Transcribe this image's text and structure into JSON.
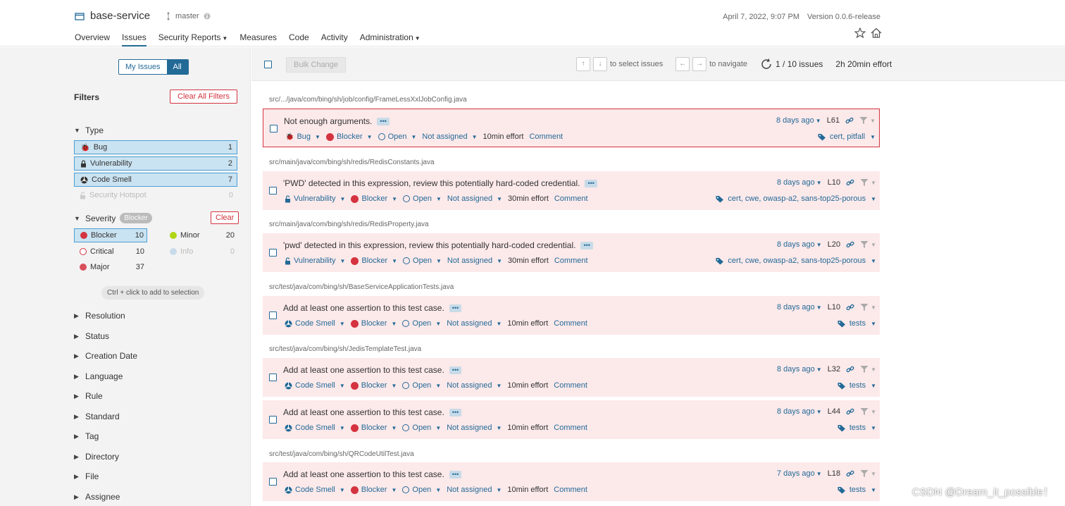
{
  "header": {
    "project": "base-service",
    "branch": "master",
    "date": "April 7, 2022, 9:07 PM",
    "version": "Version 0.0.6-release",
    "nav": [
      "Overview",
      "Issues",
      "Security Reports",
      "Measures",
      "Code",
      "Activity",
      "Administration"
    ],
    "active_nav": "Issues"
  },
  "sidebar": {
    "my_issues": "My Issues",
    "all": "All",
    "filters_title": "Filters",
    "clear_all": "Clear All Filters",
    "type": {
      "label": "Type",
      "items": [
        {
          "label": "Bug",
          "count": "1"
        },
        {
          "label": "Vulnerability",
          "count": "2"
        },
        {
          "label": "Code Smell",
          "count": "7"
        },
        {
          "label": "Security Hotspot",
          "count": "0"
        }
      ]
    },
    "severity": {
      "label": "Severity",
      "badge": "Blocker",
      "clear": "Clear",
      "items": [
        {
          "label": "Blocker",
          "count": "10"
        },
        {
          "label": "Minor",
          "count": "20"
        },
        {
          "label": "Critical",
          "count": "10"
        },
        {
          "label": "Info",
          "count": "0"
        },
        {
          "label": "Major",
          "count": "37"
        }
      ],
      "hint": "Ctrl + click to add to selection"
    },
    "facets": [
      "Resolution",
      "Status",
      "Creation Date",
      "Language",
      "Rule",
      "Standard",
      "Tag",
      "Directory",
      "File",
      "Assignee"
    ]
  },
  "toolbar": {
    "bulk": "Bulk Change",
    "up": "↑",
    "down": "↓",
    "select_hint": "to select issues",
    "left": "←",
    "right": "→",
    "nav_hint": "to navigate",
    "count": "1 / 10 issues",
    "effort": "2h 20min effort"
  },
  "issues": [
    {
      "path": "src/.../java/com/bing/sh/job/config/FrameLessXxlJobConfig.java",
      "title": "Not enough arguments.",
      "type": "Bug",
      "severity": "Blocker",
      "status": "Open",
      "assignee": "Not assigned",
      "effort": "10min effort",
      "comment": "Comment",
      "age": "8 days ago",
      "line": "L61",
      "tags": "cert, pitfall"
    },
    {
      "path": "src/main/java/com/bing/sh/redis/RedisConstants.java",
      "title": "'PWD' detected in this expression, review this potentially hard-coded credential.",
      "type": "Vulnerability",
      "severity": "Blocker",
      "status": "Open",
      "assignee": "Not assigned",
      "effort": "30min effort",
      "comment": "Comment",
      "age": "8 days ago",
      "line": "L10",
      "tags": "cert, cwe, owasp-a2, sans-top25-porous"
    },
    {
      "path": "src/main/java/com/bing/sh/redis/RedisProperty.java",
      "title": "'pwd' detected in this expression, review this potentially hard-coded credential.",
      "type": "Vulnerability",
      "severity": "Blocker",
      "status": "Open",
      "assignee": "Not assigned",
      "effort": "30min effort",
      "comment": "Comment",
      "age": "8 days ago",
      "line": "L20",
      "tags": "cert, cwe, owasp-a2, sans-top25-porous"
    },
    {
      "path": "src/test/java/com/bing/sh/BaseServiceApplicationTests.java",
      "title": "Add at least one assertion to this test case.",
      "type": "Code Smell",
      "severity": "Blocker",
      "status": "Open",
      "assignee": "Not assigned",
      "effort": "10min effort",
      "comment": "Comment",
      "age": "8 days ago",
      "line": "L10",
      "tags": "tests"
    },
    {
      "path": "src/test/java/com/bing/sh/JedisTemplateTest.java",
      "title": "Add at least one assertion to this test case.",
      "type": "Code Smell",
      "severity": "Blocker",
      "status": "Open",
      "assignee": "Not assigned",
      "effort": "10min effort",
      "comment": "Comment",
      "age": "8 days ago",
      "line": "L32",
      "tags": "tests"
    },
    {
      "path": "",
      "title": "Add at least one assertion to this test case.",
      "type": "Code Smell",
      "severity": "Blocker",
      "status": "Open",
      "assignee": "Not assigned",
      "effort": "10min effort",
      "comment": "Comment",
      "age": "8 days ago",
      "line": "L44",
      "tags": "tests"
    },
    {
      "path": "src/test/java/com/bing/sh/QRCodeUtilTest.java",
      "title": "Add at least one assertion to this test case.",
      "type": "Code Smell",
      "severity": "Blocker",
      "status": "Open",
      "assignee": "Not assigned",
      "effort": "10min effort",
      "comment": "Comment",
      "age": "7 days ago",
      "line": "L18",
      "tags": "tests"
    }
  ],
  "watermark": "CSDN @Dream_it_possible！",
  "colors": {
    "accent": "#236a97",
    "blocker": "#d4333f",
    "issue_bg": "#fce9ea",
    "selected": "#cae3f2",
    "minor": "#b0d513"
  }
}
